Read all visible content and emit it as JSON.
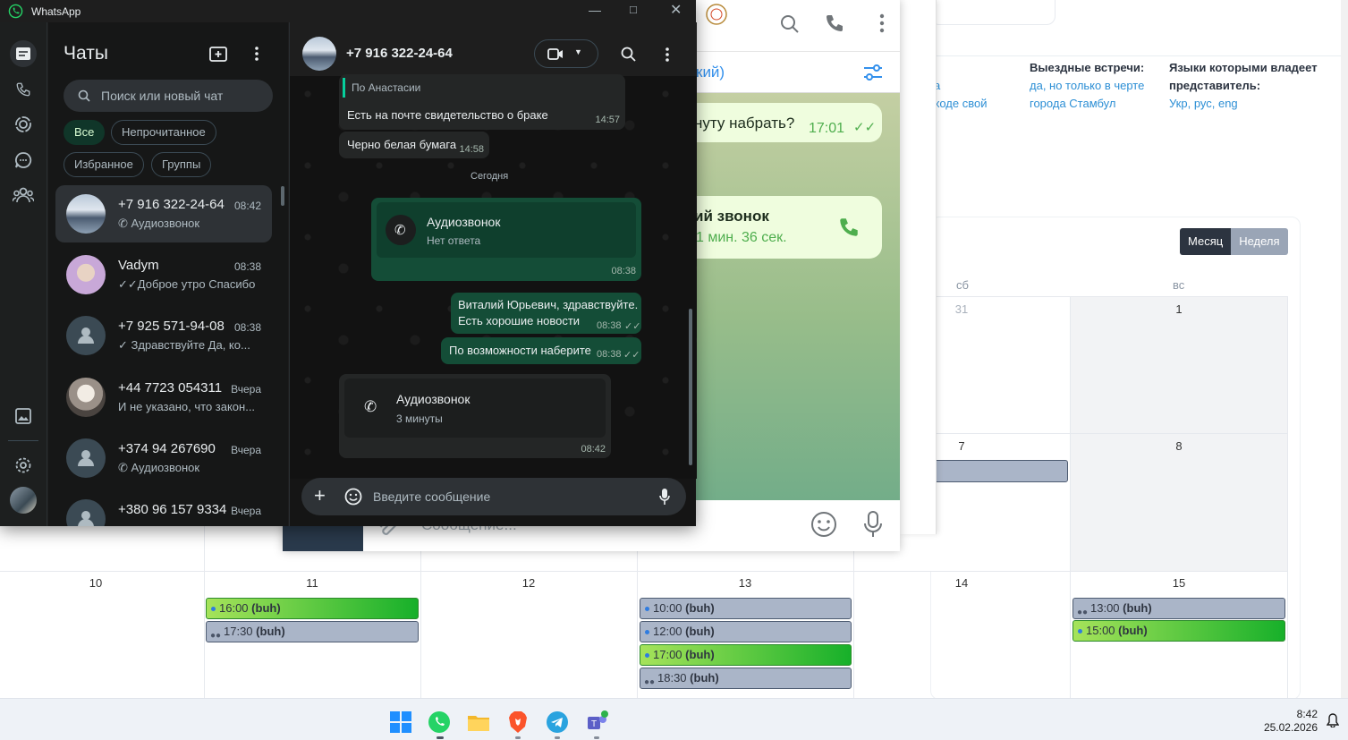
{
  "whatsapp": {
    "title": "WhatsApp",
    "list_title": "Чаты",
    "search_placeholder": "Поиск или новый чат",
    "filters": [
      "Все",
      "Непрочитанное",
      "Избранное",
      "Группы"
    ],
    "chats": [
      {
        "name": "+7 916 322-24-64",
        "time": "08:42",
        "preview": "Аудиозвонок",
        "icon": "phone-call-icon"
      },
      {
        "name": "Vadym",
        "time": "08:38",
        "preview": "Доброе утро Спасибо",
        "icon": "double-check-icon"
      },
      {
        "name": "+7 925 571-94-08",
        "time": "08:38",
        "preview": "Здравствуйте Да, ко...",
        "icon": "check-icon"
      },
      {
        "name": "+44 7723 054311",
        "time": "Вчера",
        "preview": "И не указано, что закон...",
        "icon": ""
      },
      {
        "name": "+374 94 267690",
        "time": "Вчера",
        "preview": "Аудиозвонок",
        "icon": "phone-call-icon"
      },
      {
        "name": "+380 96 157 9334",
        "time": "Вчера",
        "preview": "",
        "icon": ""
      }
    ],
    "active_chat": {
      "name": "+7 916 322-24-64",
      "quote_author": "По Анастасии",
      "messages": [
        {
          "text": "Есть на почте свидетельство о браке",
          "time": "14:57"
        },
        {
          "text": "Черно белая бумага",
          "time": "14:58"
        }
      ],
      "date_divider": "Сегодня",
      "call_out": {
        "title": "Аудиозвонок",
        "status": "Нет ответа",
        "time": "08:38"
      },
      "out_messages": [
        {
          "line1": "Виталий Юрьевич, здравствуйте.",
          "line2": "Есть хорошие новости",
          "time": "08:38"
        },
        {
          "line1": "По возможности наберите",
          "time": "08:38"
        }
      ],
      "call_in": {
        "title": "Аудиозвонок",
        "status": "3 минуты",
        "time": "08:42"
      },
      "compose_placeholder": "Введите сообщение"
    }
  },
  "telegram": {
    "subheader": "кий)",
    "msg1": "нуту набрать?",
    "msg1_time": "17:01",
    "call_title": "ий звонок",
    "call_duration": "1 мин. 36 сек.",
    "compose_placeholder": "Сообщение..."
  },
  "crm": {
    "info": [
      {
        "lines": [
          "а",
          "ходе свой"
        ]
      },
      {
        "heading": "Выездные встречи:",
        "lines": [
          "да, но только в черте",
          "города Стамбул"
        ]
      },
      {
        "heading": "Языки которыми владеет",
        "heading2": "представитель:",
        "lines": [
          "Укр, рус, eng"
        ]
      }
    ],
    "view_buttons": [
      "Месяц",
      "Неделя"
    ],
    "weekdays": [
      "сб",
      "вс"
    ],
    "row1_days": [
      "31",
      "1"
    ],
    "row2_days": [
      "7",
      "8"
    ],
    "row3_days": [
      "10",
      "11",
      "12",
      "13",
      "14",
      "15"
    ],
    "events": {
      "d11": [
        {
          "time": "16:00",
          "who": "(buh)",
          "kind": "green"
        },
        {
          "time": "17:30",
          "who": "(buh)",
          "kind": "group"
        }
      ],
      "d13": [
        {
          "time": "10:00",
          "who": "(buh)",
          "kind": "dot"
        },
        {
          "time": "12:00",
          "who": "(buh)",
          "kind": "dot"
        },
        {
          "time": "17:00",
          "who": "(buh)",
          "kind": "green"
        },
        {
          "time": "18:30",
          "who": "(buh)",
          "kind": "group"
        }
      ],
      "d15": [
        {
          "time": "13:00",
          "who": "(buh)",
          "kind": "group"
        },
        {
          "time": "15:00",
          "who": "(buh)",
          "kind": "green"
        }
      ]
    }
  },
  "taskbar": {
    "apps": [
      "windows-start-icon",
      "whatsapp-icon",
      "file-explorer-icon",
      "brave-browser-icon",
      "telegram-icon",
      "teams-icon"
    ],
    "time": "8:42",
    "date": "25.02.2026"
  },
  "colors": {
    "wa_green": "#25d366",
    "wa_out_bubble": "#144d37",
    "tg_blue": "#3390ec",
    "event_green": "#17b02a"
  }
}
